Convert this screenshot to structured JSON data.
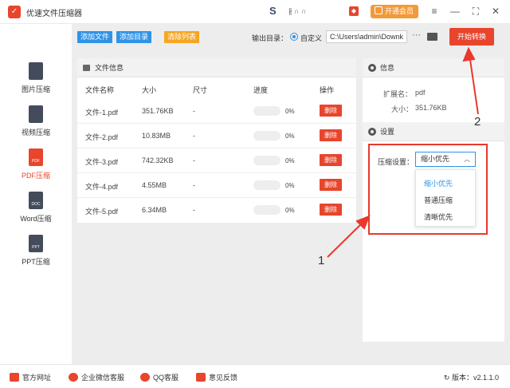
{
  "window": {
    "title": "优速文件压缩器",
    "center_logo": "S",
    "center_text": "∦ ∩ ∩",
    "vip_label": "开通会员",
    "menu_icon": "≡",
    "min_icon": "—",
    "max_icon": "⛶",
    "close_icon": "✕"
  },
  "sidebar": {
    "items": [
      {
        "label": "图片压缩",
        "icon_text": ""
      },
      {
        "label": "视频压缩",
        "icon_text": ""
      },
      {
        "label": "PDF压缩",
        "icon_text": "PDF"
      },
      {
        "label": "Word压缩",
        "icon_text": "DOC"
      },
      {
        "label": "PPT压缩",
        "icon_text": "PPT"
      }
    ]
  },
  "toolbar": {
    "add_file": "添加文件",
    "add_folder": "添加目录",
    "clear_list": "清除列表",
    "output_label": "输出目录：",
    "custom_label": "自定义",
    "path_value": "C:\\Users\\admin\\Downk",
    "more": "···",
    "start_button": "开始转换"
  },
  "file_panel": {
    "title": "文件信息",
    "headers": [
      "文件名称",
      "大小",
      "尺寸",
      "进度",
      "操作"
    ],
    "rows": [
      {
        "name": "文件-1.pdf",
        "size": "351.76KB",
        "dims": "-",
        "progress": "0%",
        "action": "删除"
      },
      {
        "name": "文件-2.pdf",
        "size": "10.83MB",
        "dims": "-",
        "progress": "0%",
        "action": "删除"
      },
      {
        "name": "文件-3.pdf",
        "size": "742.32KB",
        "dims": "-",
        "progress": "0%",
        "action": "删除"
      },
      {
        "name": "文件-4.pdf",
        "size": "4.55MB",
        "dims": "-",
        "progress": "0%",
        "action": "删除"
      },
      {
        "name": "文件-5.pdf",
        "size": "6.34MB",
        "dims": "-",
        "progress": "0%",
        "action": "删除"
      }
    ]
  },
  "info_panel": {
    "title": "信息",
    "ext_label": "扩展名：",
    "ext_value": "pdf",
    "size_label": "大小：",
    "size_value": "351.76KB"
  },
  "settings_panel": {
    "title": "设置",
    "compress_label": "压缩设置：",
    "selected": "缩小优先",
    "options": [
      "缩小优先",
      "普通压缩",
      "清晰优先"
    ]
  },
  "annotations": {
    "one": "1",
    "two": "2",
    "accent": "#e8392c"
  },
  "footer": {
    "website": "官方网址",
    "wechat": "企业微信客服",
    "qq": "QQ客服",
    "feedback": "意见反馈",
    "version": "版本：v2.1.1.0"
  }
}
